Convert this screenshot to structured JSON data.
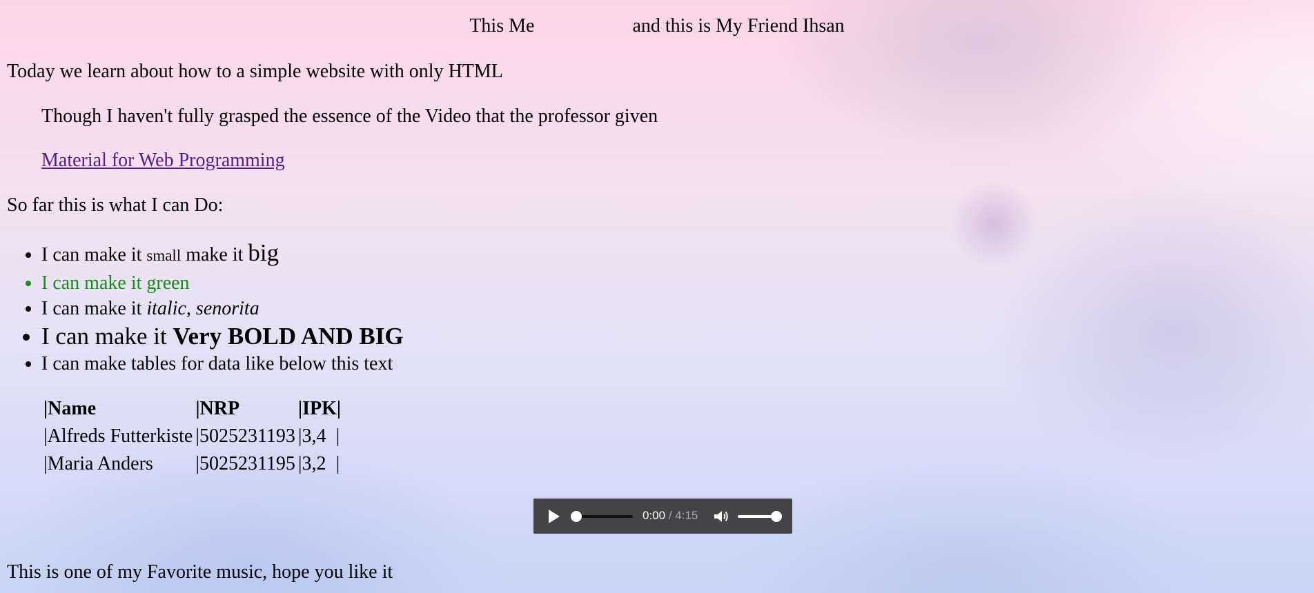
{
  "header": {
    "left_caption": "This Me",
    "right_caption": "and this is My Friend Ihsan"
  },
  "intro": {
    "line1": "Today we learn about how to a simple website with only HTML",
    "quote": "Though I haven't fully grasped the essence of the Video that the professor given",
    "link_text": "Material for Web Programming"
  },
  "skills": {
    "heading": "So far this is what I can Do:",
    "item1": {
      "prefix": "I can make it ",
      "small": "small",
      "middle": " make it ",
      "big": "big"
    },
    "item2": "I can make it green",
    "item3": {
      "prefix": "I can make it ",
      "italic": "italic, senorita"
    },
    "item4": {
      "prefix": "I can make it ",
      "bold": "Very BOLD AND BIG"
    },
    "item5": "I can make tables for data like below this text"
  },
  "table": {
    "headers": [
      "|Name",
      "|NRP",
      "|IPK|"
    ],
    "rows": [
      [
        "|Alfreds Futterkiste",
        "|5025231193",
        "|3,4",
        "|"
      ],
      [
        "|Maria Anders",
        "|5025231195",
        "|3,2",
        "|"
      ]
    ]
  },
  "audio": {
    "current_time": "0:00",
    "separator": " / ",
    "duration": "4:15",
    "progress": 0,
    "volume": 1,
    "icons": {
      "play": "play-icon",
      "volume": "volume-icon"
    }
  },
  "footer": {
    "music_text": "This is one of my Favorite music, hope you like it"
  },
  "colors": {
    "green_text": "#138f13",
    "link": "#551a8b",
    "player_bg": "#444446"
  }
}
